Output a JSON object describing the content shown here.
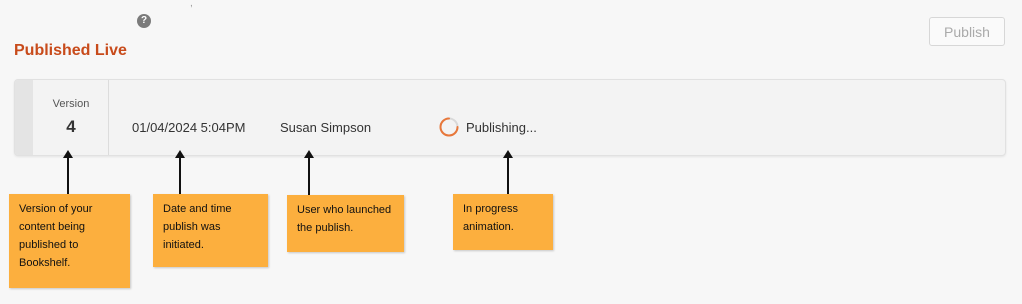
{
  "header": {
    "help_icon_glyph": "?",
    "section_title": "Published Live",
    "publish_label": "Publish"
  },
  "version": {
    "label": "Version",
    "number": "4"
  },
  "publish_row": {
    "datetime": "01/04/2024 5:04PM",
    "user": "Susan Simpson",
    "status": "Publishing..."
  },
  "annotations": [
    {
      "text": "Version of your content being published to Bookshelf."
    },
    {
      "text": "Date and time publish was initiated."
    },
    {
      "text": "User who launched the publish."
    },
    {
      "text": "In progress animation."
    }
  ],
  "colors": {
    "accent": "#c84b1b",
    "note_bg": "#fcaf3e",
    "spinner": "#e8773a"
  }
}
